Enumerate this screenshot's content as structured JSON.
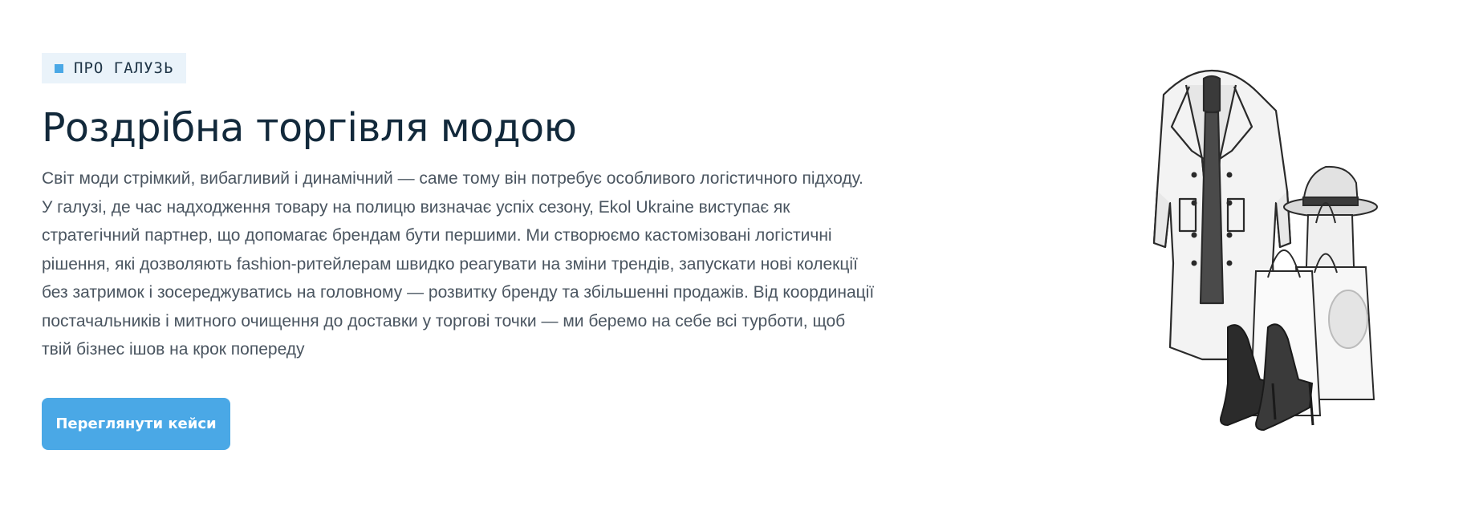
{
  "section": {
    "badge_label": "ПРО ГАЛУЗЬ",
    "title": "Роздрібна торгівля модою",
    "description": "Світ моди стрімкий, вибагливий і динамічний — саме тому він потребує особливого логістичного підходу. У галузі, де час надходження товару на полицю визначає успіх сезону, Ekol Ukraine виступає як стратегічний партнер, що допомагає брендам бути першими. Ми створюємо кастомізовані логістичні рішення, які дозволяють fashion-ритейлерам швидко реагувати на зміни трендів, запускати нові колекції без затримок і зосереджуватись на головному — розвитку бренду та збільшенні продажів. Від координації постачальників і митного очищення до доставки у торгові точки — ми беремо на себе всі турботи, щоб твій бізнес ішов на крок попереду",
    "cta_label": "Переглянути кейси"
  },
  "colors": {
    "accent": "#4aa8e6",
    "badge_bg": "#eaf3fa",
    "title": "#12293b",
    "body_text": "#4a5560"
  }
}
